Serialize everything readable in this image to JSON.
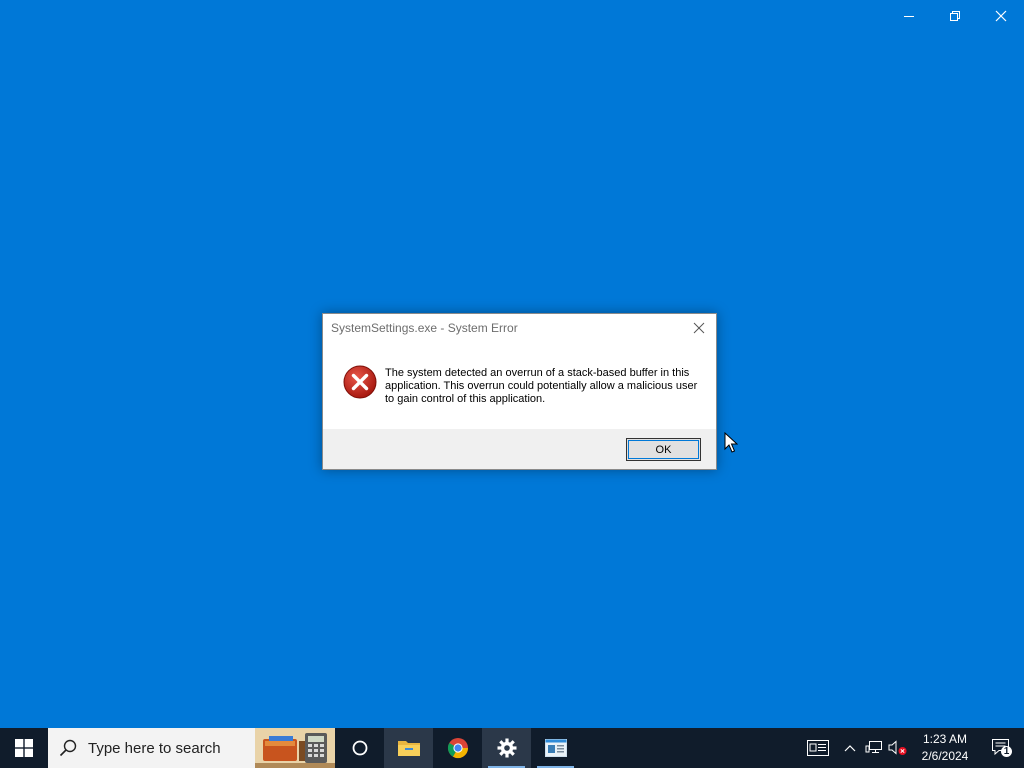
{
  "window_controls": {
    "minimize_icon": "minimize-icon",
    "restore_icon": "restore-icon",
    "close_icon": "close-icon"
  },
  "dialog": {
    "title": "SystemSettings.exe - System Error",
    "message": "The system detected an overrun of a stack-based buffer in this application. This overrun could potentially allow a malicious user to gain control of this application.",
    "ok_label": "OK",
    "icon": "error-icon"
  },
  "taskbar": {
    "search_placeholder": "Type here to search",
    "apps": [
      "cortana",
      "file-explorer",
      "chrome",
      "settings",
      "news"
    ],
    "clock_time": "1:23 AM",
    "clock_date": "2/6/2024",
    "notification_count": "1"
  },
  "colors": {
    "desktop": "#0078d7",
    "taskbar": "#101c2b",
    "error_red": "#c42b1c"
  }
}
